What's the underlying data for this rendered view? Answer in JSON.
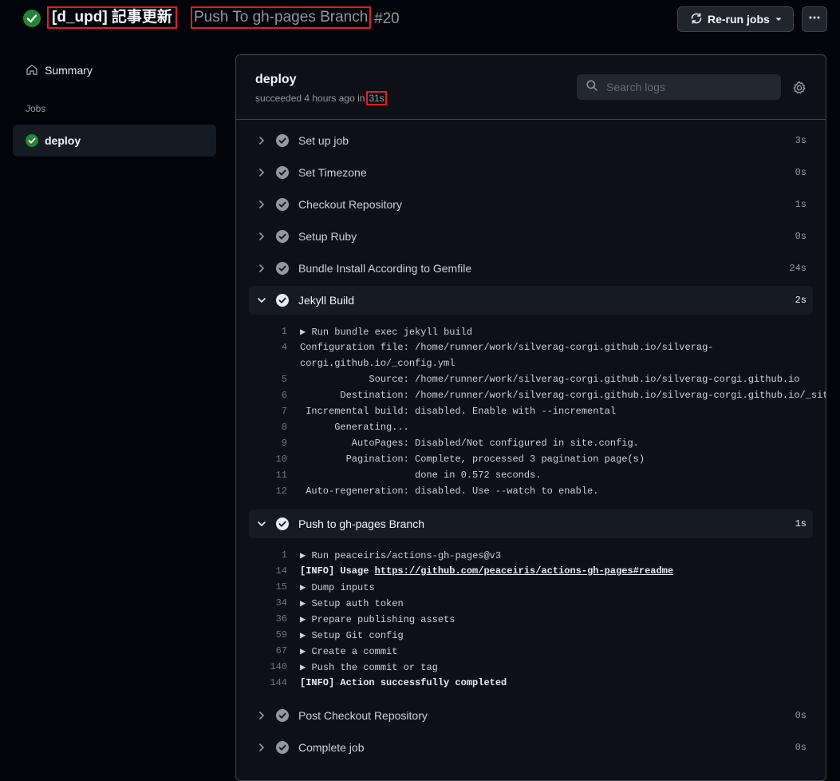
{
  "header": {
    "title": "[d_upd] 記事更新",
    "workflow": "Push To gh-pages Branch",
    "run_number": "#20",
    "rerun_label": "Re-run jobs"
  },
  "sidebar": {
    "summary_label": "Summary",
    "jobs_label": "Jobs",
    "job_label": "deploy"
  },
  "job": {
    "name": "deploy",
    "status_text": "succeeded 4 hours ago in",
    "duration": "31s",
    "search_placeholder": "Search logs"
  },
  "steps": [
    {
      "name": "Set up job",
      "duration": "3s"
    },
    {
      "name": "Set Timezone",
      "duration": "0s"
    },
    {
      "name": "Checkout Repository",
      "duration": "1s"
    },
    {
      "name": "Setup Ruby",
      "duration": "0s"
    },
    {
      "name": "Bundle Install According to Gemfile",
      "duration": "24s"
    },
    {
      "name": "Jekyll Build",
      "duration": "2s",
      "expanded": true
    },
    {
      "name": "Push to gh-pages Branch",
      "duration": "1s",
      "expanded": true
    },
    {
      "name": "Post Checkout Repository",
      "duration": "0s"
    },
    {
      "name": "Complete job",
      "duration": "0s"
    }
  ],
  "jekyll_logs": [
    {
      "n": "1",
      "text": "Run bundle exec jekyll build",
      "group": true
    },
    {
      "n": "4",
      "text": "Configuration file: /home/runner/work/silverag-corgi.github.io/silverag-"
    },
    {
      "n": "",
      "text": "corgi.github.io/_config.yml"
    },
    {
      "n": "5",
      "text": "            Source: /home/runner/work/silverag-corgi.github.io/silverag-corgi.github.io"
    },
    {
      "n": "6",
      "text": "       Destination: /home/runner/work/silverag-corgi.github.io/silverag-corgi.github.io/_site"
    },
    {
      "n": "7",
      "text": " Incremental build: disabled. Enable with --incremental"
    },
    {
      "n": "8",
      "text": "      Generating..."
    },
    {
      "n": "9",
      "text": "         AutoPages: Disabled/Not configured in site.config."
    },
    {
      "n": "10",
      "text": "        Pagination: Complete, processed 3 pagination page(s)"
    },
    {
      "n": "11",
      "text": "                    done in 0.572 seconds."
    },
    {
      "n": "12",
      "text": " Auto-regeneration: disabled. Use --watch to enable."
    }
  ],
  "push_logs": [
    {
      "n": "1",
      "text": "Run peaceiris/actions-gh-pages@v3",
      "group": true
    },
    {
      "n": "14",
      "text": "[INFO] Usage ",
      "link": "https://github.com/peaceiris/actions-gh-pages#readme",
      "bold": true
    },
    {
      "n": "15",
      "text": "Dump inputs",
      "group": true
    },
    {
      "n": "34",
      "text": "Setup auth token",
      "group": true
    },
    {
      "n": "36",
      "text": "Prepare publishing assets",
      "group": true
    },
    {
      "n": "59",
      "text": "Setup Git config",
      "group": true
    },
    {
      "n": "67",
      "text": "Create a commit",
      "group": true
    },
    {
      "n": "140",
      "text": "Push the commit or tag",
      "group": true
    },
    {
      "n": "144",
      "text": "[INFO] Action successfully completed",
      "bold": true
    }
  ],
  "colors": {
    "success": "#238636",
    "highlight_box": "#e0201d",
    "step_check": "#9198a1"
  }
}
